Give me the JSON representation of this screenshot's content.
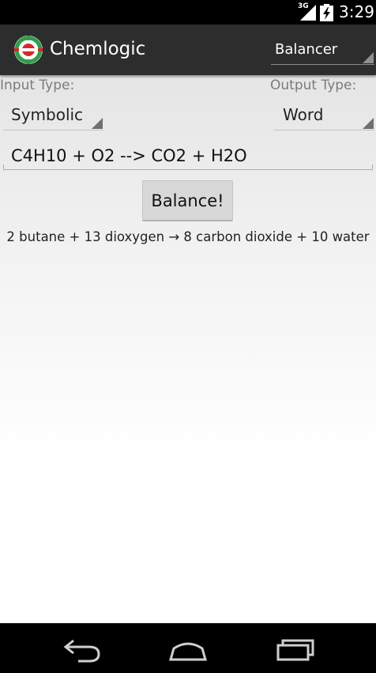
{
  "status_bar": {
    "network": "3G",
    "time": "3:29"
  },
  "action_bar": {
    "title": "Chemlogic",
    "mode_selected": "Balancer"
  },
  "form": {
    "input_type_label": "Input Type:",
    "input_type_value": "Symbolic",
    "output_type_label": "Output Type:",
    "output_type_value": "Word",
    "equation_value": "C4H10 + O2 --> CO2 + H2O",
    "balance_button_label": "Balance!",
    "result": "2 butane + 13 dioxygen → 8 carbon dioxide + 10 water"
  },
  "nav_bar": {
    "icons": [
      "back-icon",
      "home-icon",
      "recents-icon"
    ]
  },
  "colors": {
    "action_bar_bg": "#2d2d2d",
    "button_bg": "#d8d8d8",
    "logo_green": "#2e9e4a",
    "logo_red": "#d62a2a"
  }
}
